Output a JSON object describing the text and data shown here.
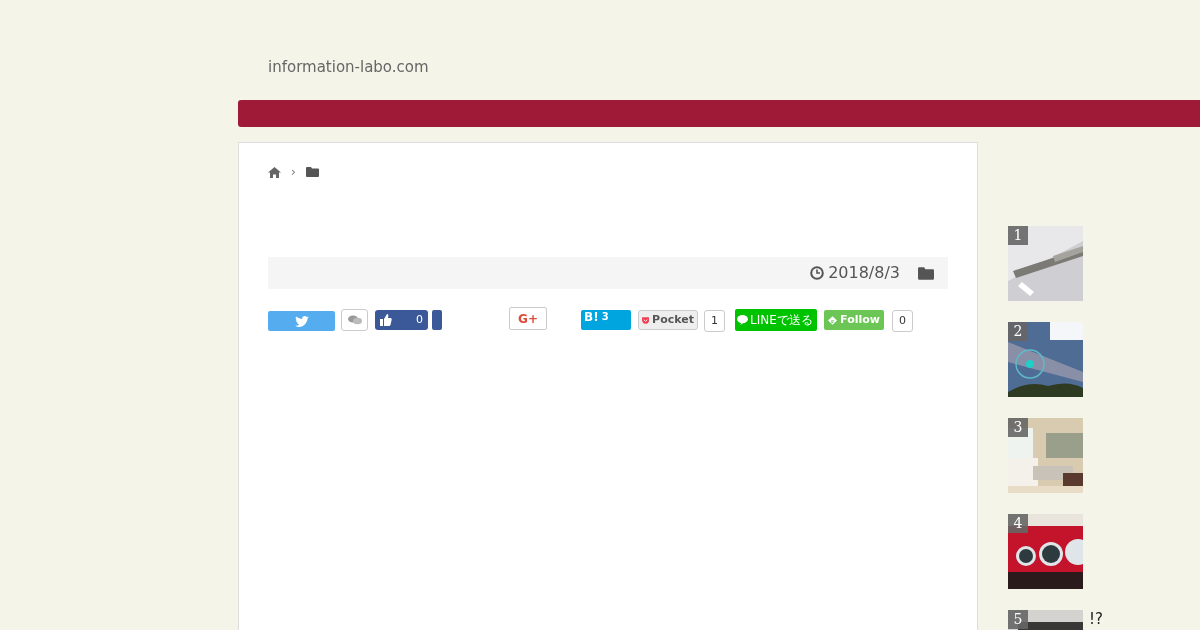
{
  "site_title": "information-labo.com",
  "breadcrumb": {
    "separator": "›"
  },
  "meta": {
    "date": "2018/8/3"
  },
  "share_buttons": [
    {
      "kind": "twitter"
    },
    {
      "kind": "facebook",
      "count": "0"
    },
    {
      "kind": "gplus",
      "label": "G+"
    },
    {
      "kind": "hatena",
      "label": "B!",
      "count": "3"
    },
    {
      "kind": "pocket",
      "label": "Pocket",
      "count": "1"
    },
    {
      "kind": "line",
      "label": "LINEで送る"
    },
    {
      "kind": "feedly",
      "label": "Follow",
      "count": "0"
    }
  ],
  "ranking": [
    {
      "rank": "1",
      "kind": "picture"
    },
    {
      "rank": "2",
      "kind": "picture"
    },
    {
      "rank": "3",
      "kind": "picture"
    },
    {
      "rank": "4",
      "kind": "picture"
    },
    {
      "rank": "5",
      "kind": "picture",
      "title": "!?"
    }
  ]
}
